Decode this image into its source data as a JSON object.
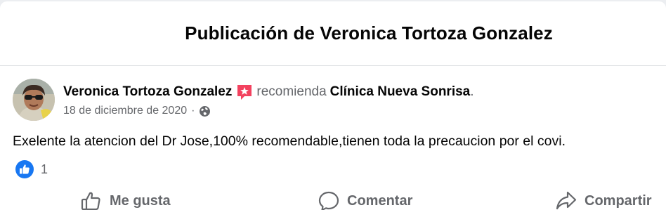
{
  "dialog": {
    "title": "Publicación de Veronica Tortoza Gonzalez"
  },
  "post": {
    "author": "Veronica Tortoza Gonzalez",
    "recommends_text": "recomienda",
    "page_name": "Clínica Nueva Sonrisa",
    "period": ".",
    "date": "18 de diciembre de 2020",
    "separator": "·",
    "privacy_icon": "globe-icon",
    "body": "Exelente la atencion del Dr Jose,100% recomendable,tienen toda la precaucion por el covi."
  },
  "reactions": {
    "icon": "like-reaction-icon",
    "count": "1",
    "color": "#1877f2"
  },
  "actions": {
    "like": {
      "label": "Me gusta",
      "icon": "thumbs-up-icon"
    },
    "comment": {
      "label": "Comentar",
      "icon": "comment-icon"
    },
    "share": {
      "label": "Compartir",
      "icon": "share-icon"
    }
  },
  "colors": {
    "secondary_text": "#65676b",
    "primary_text": "#050505",
    "recommend_badge": "#f3425f"
  }
}
